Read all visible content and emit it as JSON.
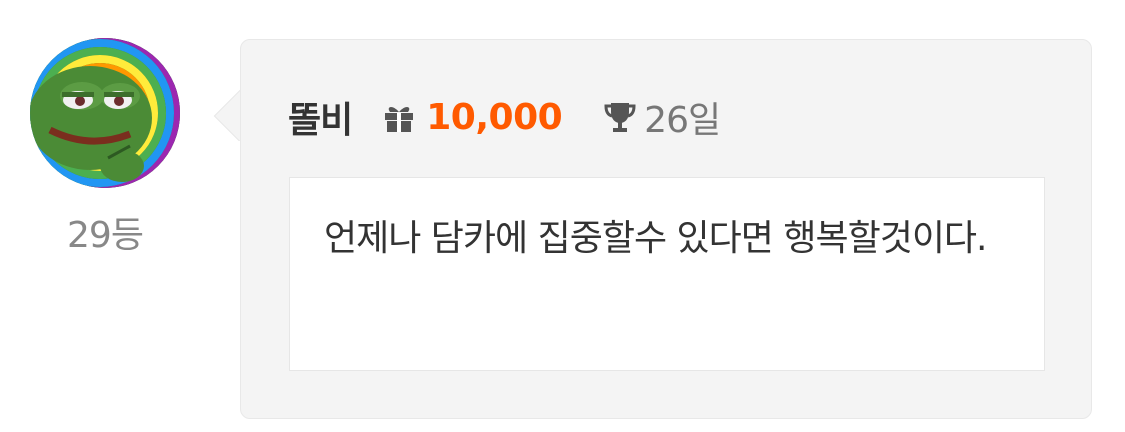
{
  "author": {
    "avatar_icon": "pepe-frog-avatar-icon",
    "rank": "29등",
    "nickname": "똘비"
  },
  "stats": {
    "gift_icon": "gift-icon",
    "points": "10,000",
    "points_color": "#ff5a00",
    "trophy_icon": "trophy-icon",
    "days": "26일"
  },
  "comment": {
    "text": "언제나 담카에 집중할수 있다면 행복할것이다."
  }
}
